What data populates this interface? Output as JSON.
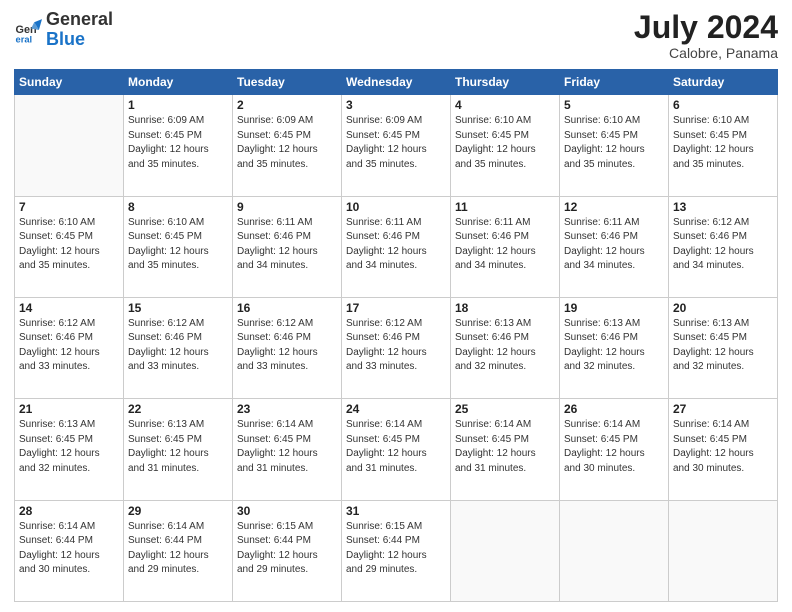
{
  "header": {
    "logo_general": "General",
    "logo_blue": "Blue",
    "month_year": "July 2024",
    "location": "Calobre, Panama"
  },
  "days_of_week": [
    "Sunday",
    "Monday",
    "Tuesday",
    "Wednesday",
    "Thursday",
    "Friday",
    "Saturday"
  ],
  "weeks": [
    [
      {
        "day": "",
        "info": ""
      },
      {
        "day": "1",
        "info": "Sunrise: 6:09 AM\nSunset: 6:45 PM\nDaylight: 12 hours\nand 35 minutes."
      },
      {
        "day": "2",
        "info": "Sunrise: 6:09 AM\nSunset: 6:45 PM\nDaylight: 12 hours\nand 35 minutes."
      },
      {
        "day": "3",
        "info": "Sunrise: 6:09 AM\nSunset: 6:45 PM\nDaylight: 12 hours\nand 35 minutes."
      },
      {
        "day": "4",
        "info": "Sunrise: 6:10 AM\nSunset: 6:45 PM\nDaylight: 12 hours\nand 35 minutes."
      },
      {
        "day": "5",
        "info": "Sunrise: 6:10 AM\nSunset: 6:45 PM\nDaylight: 12 hours\nand 35 minutes."
      },
      {
        "day": "6",
        "info": "Sunrise: 6:10 AM\nSunset: 6:45 PM\nDaylight: 12 hours\nand 35 minutes."
      }
    ],
    [
      {
        "day": "7",
        "info": "Sunrise: 6:10 AM\nSunset: 6:45 PM\nDaylight: 12 hours\nand 35 minutes."
      },
      {
        "day": "8",
        "info": "Sunrise: 6:10 AM\nSunset: 6:45 PM\nDaylight: 12 hours\nand 35 minutes."
      },
      {
        "day": "9",
        "info": "Sunrise: 6:11 AM\nSunset: 6:46 PM\nDaylight: 12 hours\nand 34 minutes."
      },
      {
        "day": "10",
        "info": "Sunrise: 6:11 AM\nSunset: 6:46 PM\nDaylight: 12 hours\nand 34 minutes."
      },
      {
        "day": "11",
        "info": "Sunrise: 6:11 AM\nSunset: 6:46 PM\nDaylight: 12 hours\nand 34 minutes."
      },
      {
        "day": "12",
        "info": "Sunrise: 6:11 AM\nSunset: 6:46 PM\nDaylight: 12 hours\nand 34 minutes."
      },
      {
        "day": "13",
        "info": "Sunrise: 6:12 AM\nSunset: 6:46 PM\nDaylight: 12 hours\nand 34 minutes."
      }
    ],
    [
      {
        "day": "14",
        "info": "Sunrise: 6:12 AM\nSunset: 6:46 PM\nDaylight: 12 hours\nand 33 minutes."
      },
      {
        "day": "15",
        "info": "Sunrise: 6:12 AM\nSunset: 6:46 PM\nDaylight: 12 hours\nand 33 minutes."
      },
      {
        "day": "16",
        "info": "Sunrise: 6:12 AM\nSunset: 6:46 PM\nDaylight: 12 hours\nand 33 minutes."
      },
      {
        "day": "17",
        "info": "Sunrise: 6:12 AM\nSunset: 6:46 PM\nDaylight: 12 hours\nand 33 minutes."
      },
      {
        "day": "18",
        "info": "Sunrise: 6:13 AM\nSunset: 6:46 PM\nDaylight: 12 hours\nand 32 minutes."
      },
      {
        "day": "19",
        "info": "Sunrise: 6:13 AM\nSunset: 6:46 PM\nDaylight: 12 hours\nand 32 minutes."
      },
      {
        "day": "20",
        "info": "Sunrise: 6:13 AM\nSunset: 6:45 PM\nDaylight: 12 hours\nand 32 minutes."
      }
    ],
    [
      {
        "day": "21",
        "info": "Sunrise: 6:13 AM\nSunset: 6:45 PM\nDaylight: 12 hours\nand 32 minutes."
      },
      {
        "day": "22",
        "info": "Sunrise: 6:13 AM\nSunset: 6:45 PM\nDaylight: 12 hours\nand 31 minutes."
      },
      {
        "day": "23",
        "info": "Sunrise: 6:14 AM\nSunset: 6:45 PM\nDaylight: 12 hours\nand 31 minutes."
      },
      {
        "day": "24",
        "info": "Sunrise: 6:14 AM\nSunset: 6:45 PM\nDaylight: 12 hours\nand 31 minutes."
      },
      {
        "day": "25",
        "info": "Sunrise: 6:14 AM\nSunset: 6:45 PM\nDaylight: 12 hours\nand 31 minutes."
      },
      {
        "day": "26",
        "info": "Sunrise: 6:14 AM\nSunset: 6:45 PM\nDaylight: 12 hours\nand 30 minutes."
      },
      {
        "day": "27",
        "info": "Sunrise: 6:14 AM\nSunset: 6:45 PM\nDaylight: 12 hours\nand 30 minutes."
      }
    ],
    [
      {
        "day": "28",
        "info": "Sunrise: 6:14 AM\nSunset: 6:44 PM\nDaylight: 12 hours\nand 30 minutes."
      },
      {
        "day": "29",
        "info": "Sunrise: 6:14 AM\nSunset: 6:44 PM\nDaylight: 12 hours\nand 29 minutes."
      },
      {
        "day": "30",
        "info": "Sunrise: 6:15 AM\nSunset: 6:44 PM\nDaylight: 12 hours\nand 29 minutes."
      },
      {
        "day": "31",
        "info": "Sunrise: 6:15 AM\nSunset: 6:44 PM\nDaylight: 12 hours\nand 29 minutes."
      },
      {
        "day": "",
        "info": ""
      },
      {
        "day": "",
        "info": ""
      },
      {
        "day": "",
        "info": ""
      }
    ]
  ]
}
